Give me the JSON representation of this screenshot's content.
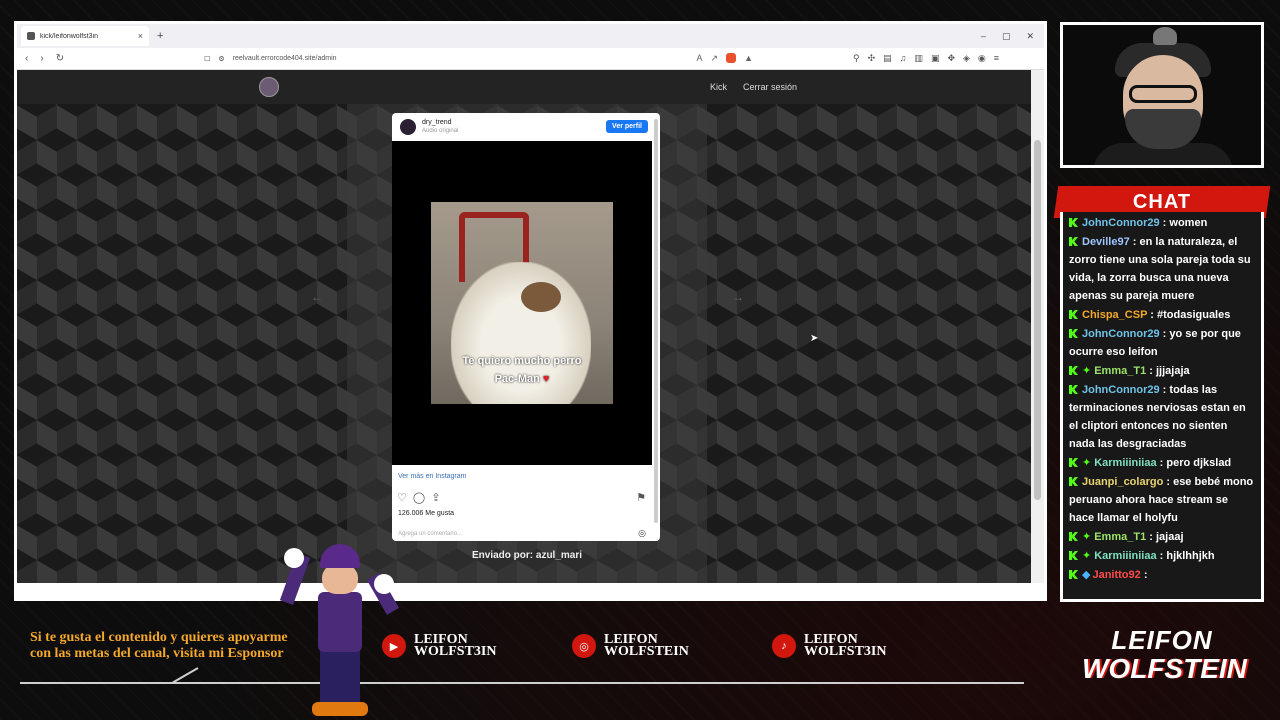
{
  "browser": {
    "tab_title": "kick/leifonwolfst3in",
    "new_tab": "+",
    "tab_close": "×",
    "address": "reelvault.errorcode404.site/admin"
  },
  "site": {
    "nav": [
      {
        "label": "Kick"
      },
      {
        "label": "Cerrar sesión"
      }
    ],
    "prev_arrow": "←",
    "next_arrow": "→"
  },
  "instagram": {
    "username": "dry_trend",
    "subtitle": "Audio original",
    "profile_button": "Ver perfil",
    "caption_line1": "Te quiero mucho perro",
    "caption_line2": "Pac-Man",
    "view_more": "Ver más en Instagram",
    "likes": "126.006 Me gusta",
    "comment_placeholder": "Agrega un comentario..."
  },
  "sent_by": "Enviado por: azul_mari",
  "chat": {
    "title": "CHAT",
    "messages": [
      {
        "user": "JohnConnor29",
        "color": "#6fc3e8",
        "badges": "k",
        "text": " : women"
      },
      {
        "user": "Deville97",
        "color": "#9ec6ff",
        "badges": "k",
        "text": " : en la naturaleza, el zorro tiene una sola pareja toda su vida, la zorra busca una nueva apenas su pareja muere"
      },
      {
        "user": "Chispa_CSP",
        "color": "#f4a82a",
        "badges": "k",
        "text": " : #todasiguales"
      },
      {
        "user": "JohnConnor29",
        "color": "#6fc3e8",
        "badges": "k",
        "text": " : yo se por que ocurre eso leifon"
      },
      {
        "user": "Emma_T1",
        "color": "#9be26a",
        "badges": "ks",
        "text": " : jjjajaja"
      },
      {
        "user": "JohnConnor29",
        "color": "#6fc3e8",
        "badges": "k",
        "text": " : todas las terminaciones nerviosas estan en el cliptori entonces no sienten nada las desgraciadas"
      },
      {
        "user": "Karmiiiniiaa",
        "color": "#7ee0c0",
        "badges": "ks",
        "text": " : pero djkslad"
      },
      {
        "user": "Juanpi_colargo",
        "color": "#e8d36f",
        "badges": "k",
        "text": " : ese bebé mono peruano ahora hace stream se hace llamar el holyfu"
      },
      {
        "user": "Emma_T1",
        "color": "#9be26a",
        "badges": "ks",
        "text": " : jajaaj"
      },
      {
        "user": "Karmiiiniiaa",
        "color": "#7ee0c0",
        "badges": "ks",
        "text": " : hjklhhjkh"
      },
      {
        "user": "Janitto92",
        "color": "#ff4a4a",
        "badges": "kg",
        "text": " : "
      }
    ]
  },
  "sponsor_text": "Si te gusta el contenido y quieres apoyarme con las metas del canal, visita mi Esponsor",
  "socials": [
    {
      "icon": "youtube-icon",
      "glyph": "▶",
      "line1": "LEIFON",
      "line2": "WOLFST3IN"
    },
    {
      "icon": "instagram-icon",
      "glyph": "◎",
      "line1": "LEIFON",
      "line2": "WOLFSTEIN"
    },
    {
      "icon": "tiktok-icon",
      "glyph": "♪",
      "line1": "LEIFON",
      "line2": "WOLFST3IN"
    }
  ],
  "brand": {
    "line1": "LEIFON",
    "line2": "WOLFSTEIN"
  },
  "colors": {
    "accent_red": "#d2170f",
    "kick_green": "#53fc18",
    "sponsor_orange": "#f4a82a",
    "ig_blue": "#1877f2"
  }
}
